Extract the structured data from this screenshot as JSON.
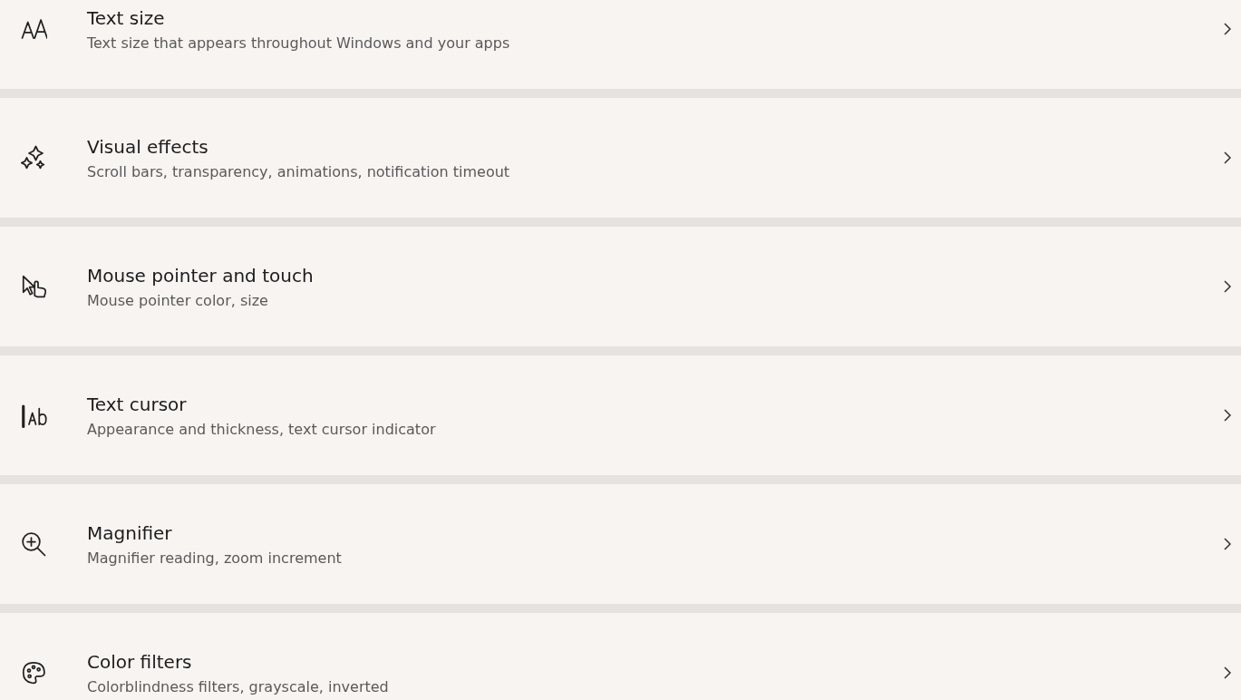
{
  "settings": [
    {
      "kind": "text-size",
      "title": "Text size",
      "subtitle": "Text size that appears throughout Windows and your apps"
    },
    {
      "kind": "effects",
      "title": "Visual effects",
      "subtitle": "Scroll bars, transparency, animations, notification timeout"
    },
    {
      "kind": "pointer",
      "title": "Mouse pointer and touch",
      "subtitle": "Mouse pointer color, size"
    },
    {
      "kind": "cursor",
      "title": "Text cursor",
      "subtitle": "Appearance and thickness, text cursor indicator"
    },
    {
      "kind": "magnifier",
      "title": "Magnifier",
      "subtitle": "Magnifier reading, zoom increment"
    },
    {
      "kind": "filters",
      "title": "Color filters",
      "subtitle": "Colorblindness filters, grayscale, inverted"
    }
  ]
}
